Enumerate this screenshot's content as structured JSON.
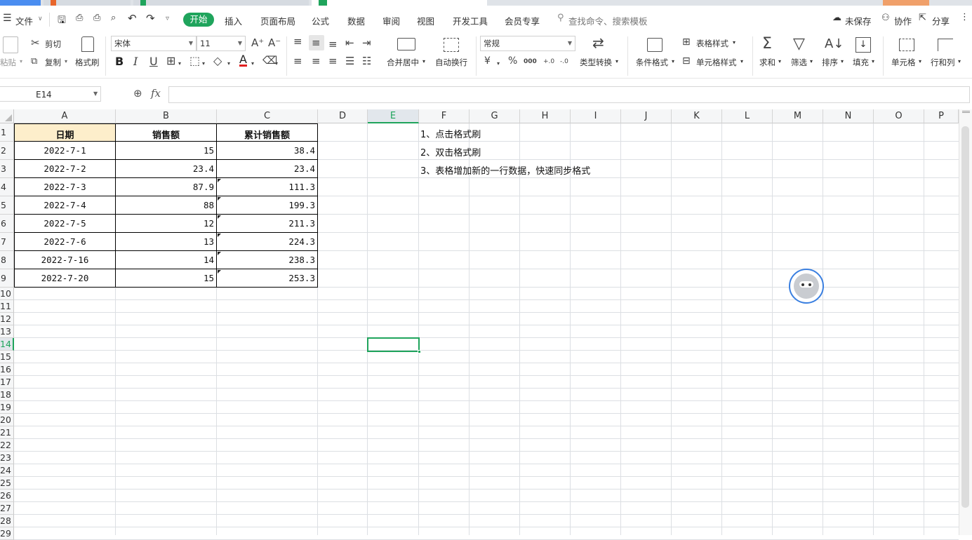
{
  "menu": {
    "file": "文件",
    "tabs": [
      "开始",
      "插入",
      "页面布局",
      "公式",
      "数据",
      "审阅",
      "视图",
      "开发工具",
      "会员专享"
    ],
    "search_placeholder": "查找命令、搜索模板",
    "unsaved": "未保存",
    "collab": "协作",
    "share": "分享"
  },
  "ribbon": {
    "paste": "粘贴",
    "cut": "剪切",
    "copy": "复制",
    "format_painter": "格式刷",
    "font_name": "宋体",
    "font_size": "11",
    "merge_center": "合并居中",
    "wrap_text": "自动换行",
    "number_format": "常规",
    "type_convert": "类型转换",
    "conditional_format": "条件格式",
    "table_style": "表格样式",
    "cell_style": "单元格样式",
    "sum": "求和",
    "filter": "筛选",
    "sort": "排序",
    "fill": "填充",
    "cell": "单元格",
    "row_col": "行和列",
    "bold": "B",
    "italic": "I",
    "underline": "U",
    "font_color_label": "A",
    "currency": "¥",
    "percent": "%",
    "thousands": "000",
    "decimal_inc": "+.0",
    "decimal_dec": "-.0"
  },
  "formula_bar": {
    "name_box": "E14",
    "fx": "fx",
    "formula": ""
  },
  "columns": [
    "A",
    "B",
    "C",
    "D",
    "E",
    "F",
    "G",
    "H",
    "I",
    "J",
    "K",
    "L",
    "M",
    "N",
    "O",
    "P"
  ],
  "rows": [
    "1",
    "2",
    "3",
    "4",
    "5",
    "6",
    "7",
    "8",
    "9",
    "10",
    "11",
    "12",
    "13",
    "14",
    "15",
    "16",
    "17",
    "18",
    "19",
    "20",
    "21",
    "22",
    "23",
    "24",
    "25",
    "26",
    "27",
    "28",
    "29"
  ],
  "selected_cell": "E14",
  "table": {
    "headers": [
      "日期",
      "销售额",
      "累计销售额"
    ],
    "rows": [
      [
        "2022-7-1",
        "15",
        "38.4"
      ],
      [
        "2022-7-2",
        "23.4",
        "23.4"
      ],
      [
        "2022-7-3",
        "87.9",
        "111.3"
      ],
      [
        "2022-7-4",
        "88",
        "199.3"
      ],
      [
        "2022-7-5",
        "12",
        "211.3"
      ],
      [
        "2022-7-6",
        "13",
        "224.3"
      ],
      [
        "2022-7-16",
        "14",
        "238.3"
      ],
      [
        "2022-7-20",
        "15",
        "253.3"
      ]
    ]
  },
  "notes": [
    "1、点击格式刷",
    "2、双击格式刷",
    "3、表格增加新的一行数据，快速同步格式"
  ],
  "colors": {
    "accent": "#1fa45c",
    "header_fill": "#fdeecb",
    "grid_line": "#dcdfe3"
  }
}
